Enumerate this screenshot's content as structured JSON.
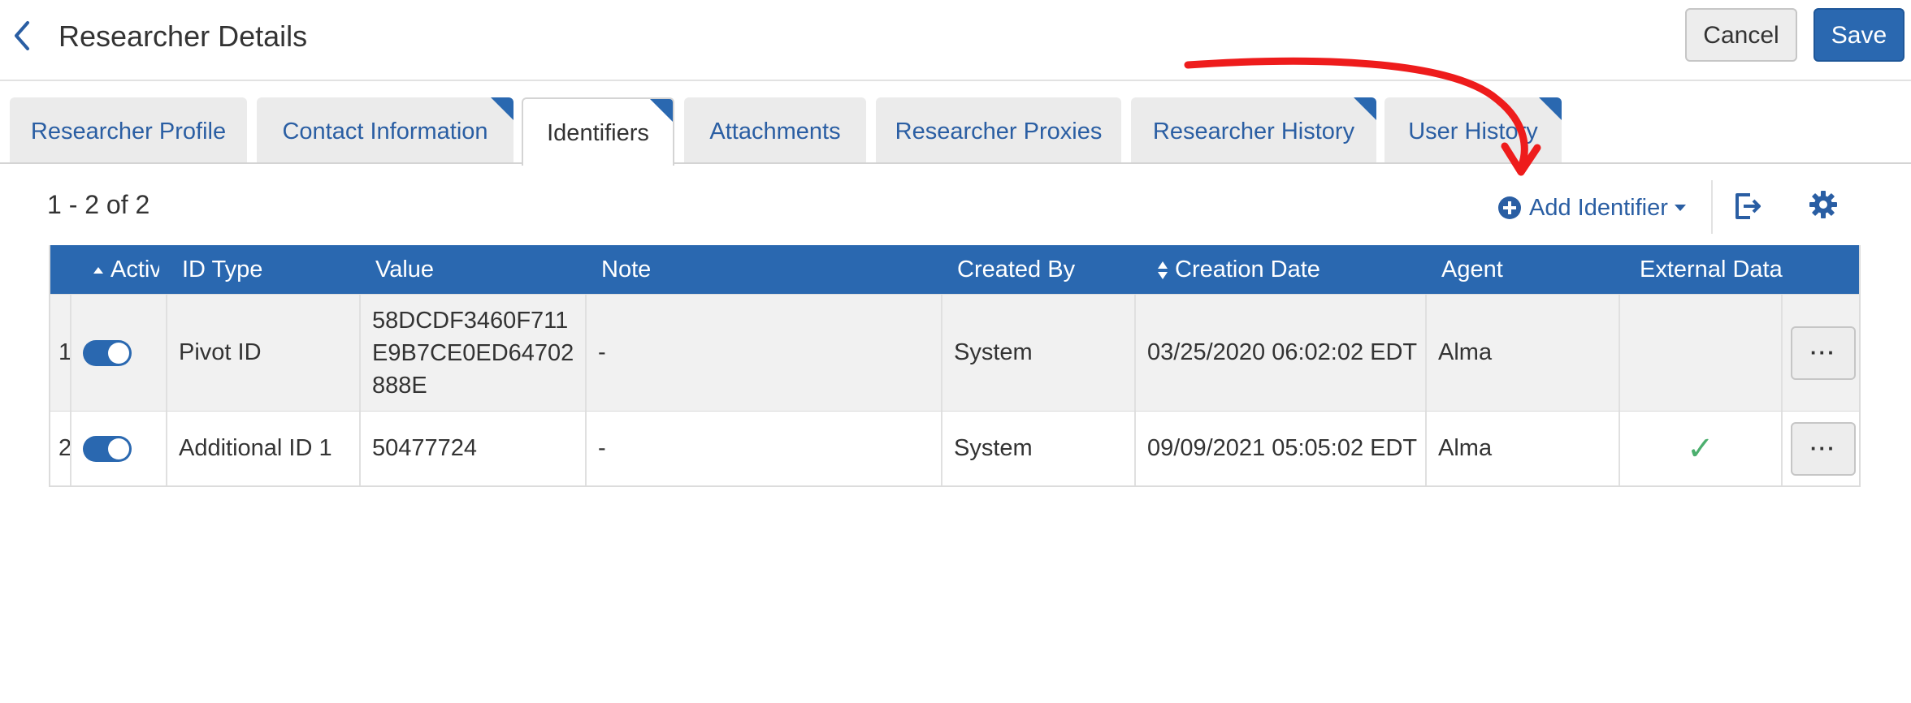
{
  "header": {
    "title": "Researcher Details",
    "cancel_label": "Cancel",
    "save_label": "Save"
  },
  "tabs": [
    {
      "label": "Researcher Profile",
      "active": false,
      "corner": false
    },
    {
      "label": "Contact Information",
      "active": false,
      "corner": true
    },
    {
      "label": "Identifiers",
      "active": true,
      "corner": true
    },
    {
      "label": "Attachments",
      "active": false,
      "corner": false
    },
    {
      "label": "Researcher Proxies",
      "active": false,
      "corner": false
    },
    {
      "label": "Researcher History",
      "active": false,
      "corner": true
    },
    {
      "label": "User History",
      "active": false,
      "corner": true
    }
  ],
  "toolbar": {
    "count": "1 - 2 of 2",
    "add_identifier_label": "Add Identifier",
    "icons": [
      "plus-circle-icon",
      "export-icon",
      "gear-icon"
    ]
  },
  "table": {
    "columns": [
      "Active",
      "ID Type",
      "Value",
      "Note",
      "Created By",
      "Creation Date",
      "Agent",
      "External Data"
    ],
    "rows": [
      {
        "num": "1",
        "active": true,
        "id_type": "Pivot ID",
        "value": "58DCDF3460F711E9B7CE0ED64702888E",
        "note": "-",
        "created_by": "System",
        "creation_date": "03/25/2020 06:02:02 EDT",
        "agent": "Alma",
        "external_data": false,
        "more_label": "···"
      },
      {
        "num": "2",
        "active": true,
        "id_type": "Additional ID 1",
        "value": "50477724",
        "note": "-",
        "created_by": "System",
        "creation_date": "09/09/2021 05:05:02 EDT",
        "agent": "Alma",
        "external_data": true,
        "more_label": "···"
      }
    ]
  },
  "colors": {
    "primary": "#2a68b0",
    "link": "#2a5ea3",
    "annotation_arrow": "#ee1c1c",
    "check": "#4caf6e"
  }
}
